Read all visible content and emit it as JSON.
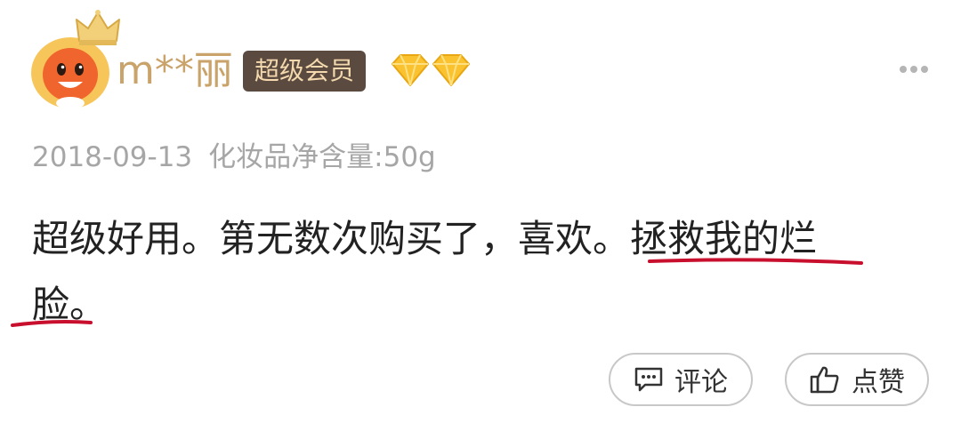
{
  "user": {
    "name": "m**丽",
    "vip_badge": "超级会员",
    "crown_icon": "crown-icon",
    "avatar_icon": "mascot-avatar",
    "diamond_icon": "diamond-icon",
    "name_color": "#c9a36a"
  },
  "menu": {
    "icon": "more-dots-icon"
  },
  "meta": {
    "date": "2018-09-13",
    "spec": "化妆品净含量:50g"
  },
  "review": {
    "text_plain": "超级好用。第无数次购买了，喜欢。",
    "text_highlight_1": "拯救我的烂",
    "text_highlight_2": "脸",
    "text_end": "。",
    "highlight_color": "#c8102e"
  },
  "actions": {
    "comment_label": "评论",
    "comment_icon": "comment-icon",
    "like_label": "点赞",
    "like_icon": "thumbs-up-icon"
  }
}
